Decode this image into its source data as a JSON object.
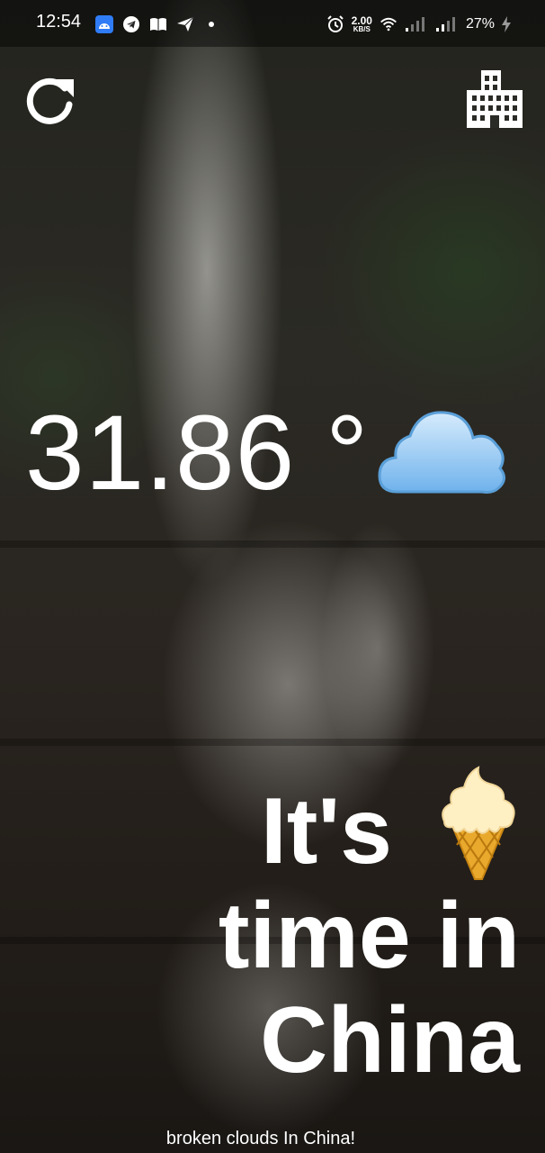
{
  "status_bar": {
    "time": "12:54",
    "app_icons": [
      "android-icon",
      "telegram-icon",
      "book-icon",
      "send-icon"
    ],
    "net_speed_value": "2.00",
    "net_speed_unit": "KB/S",
    "battery": "27%"
  },
  "toolbar": {
    "refresh_icon": "refresh-icon",
    "city_icon": "city-buildings-icon"
  },
  "weather": {
    "temperature": "31.86 °",
    "condition_icon": "cloud-icon"
  },
  "message": {
    "line1": "It's",
    "line1_icon": "ice-cream-icon",
    "line2": "time in",
    "line3": "China"
  },
  "description": "broken clouds In China!",
  "colors": {
    "text": "#ffffff",
    "cloud_fill": "#7fbef0",
    "cloud_light": "#cfe6fb",
    "cone": "#e8a72b",
    "cream": "#fff1c8"
  }
}
